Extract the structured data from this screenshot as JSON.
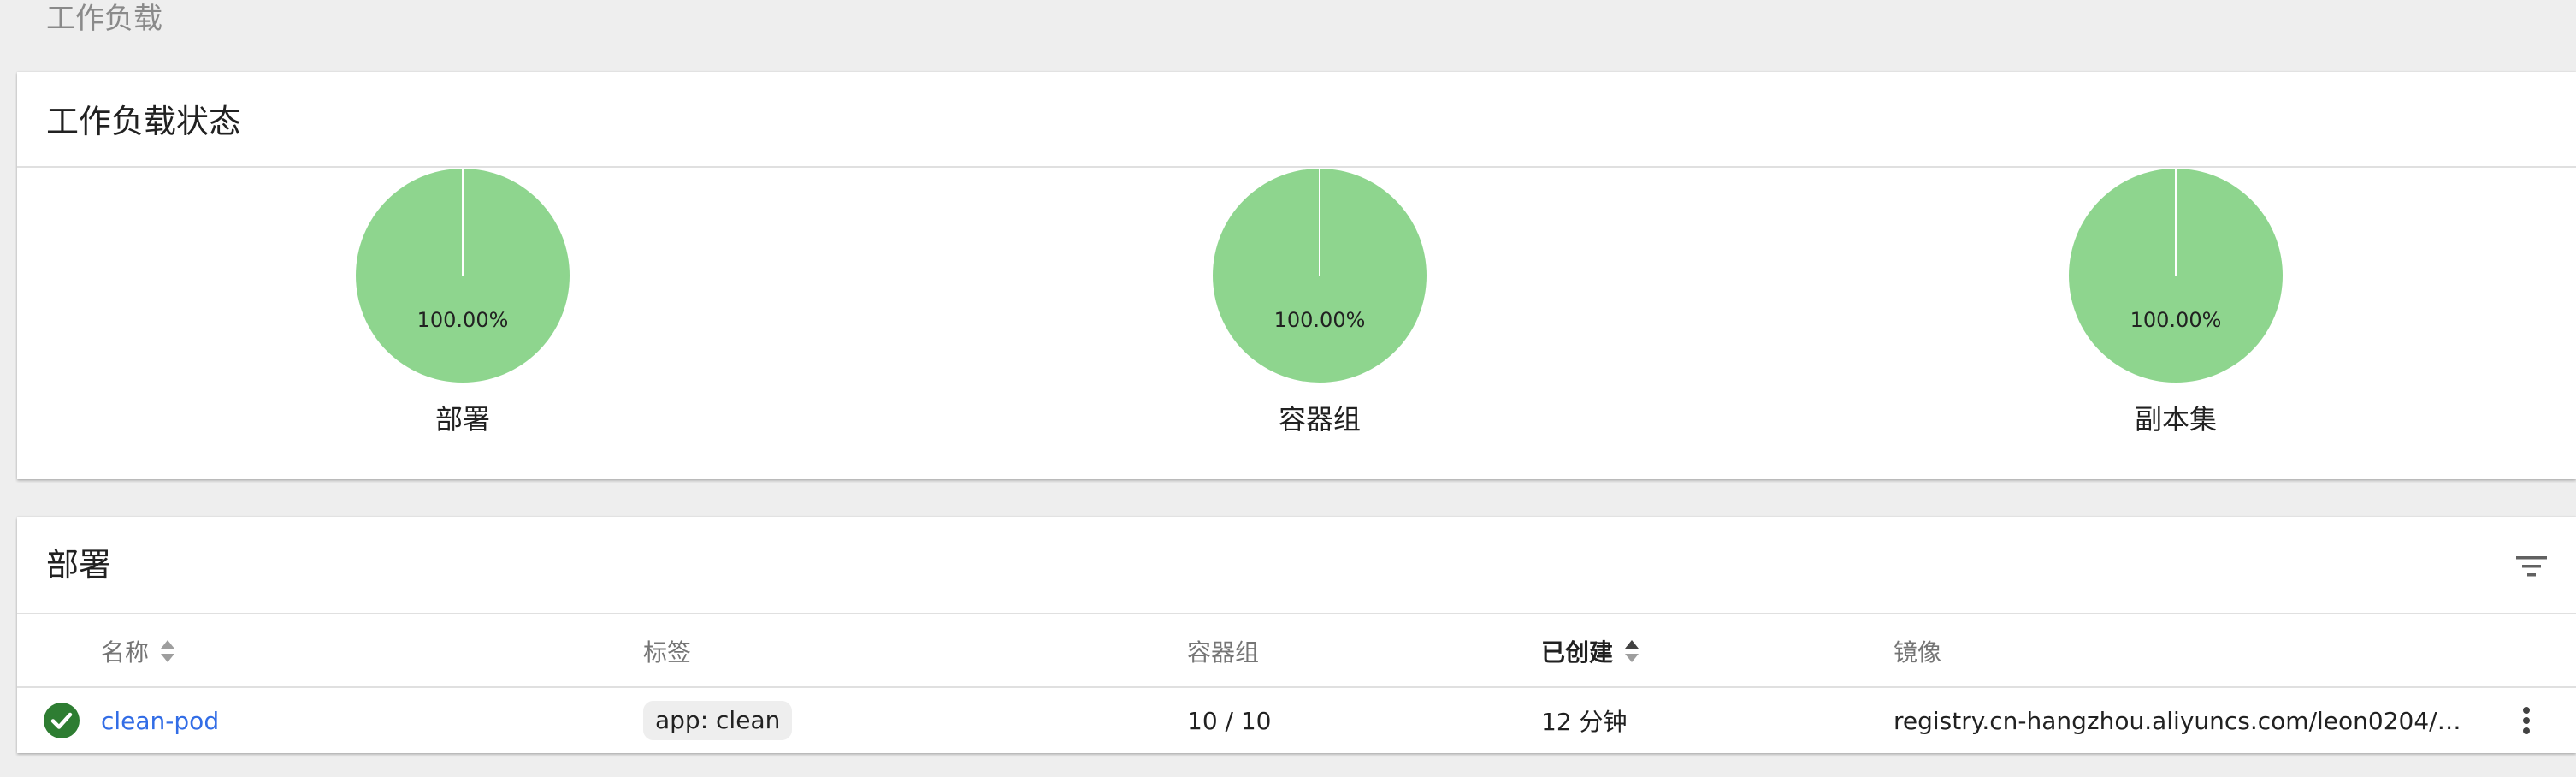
{
  "page": {
    "heading": "工作负载"
  },
  "status_card": {
    "title": "工作负载状态",
    "charts": [
      {
        "label": "部署",
        "percent_text": "100.00%",
        "running_fraction": 1.0,
        "color": "#8ed58e"
      },
      {
        "label": "容器组",
        "percent_text": "100.00%",
        "running_fraction": 1.0,
        "color": "#8ed58e"
      },
      {
        "label": "副本集",
        "percent_text": "100.00%",
        "running_fraction": 1.0,
        "color": "#8ed58e"
      }
    ]
  },
  "deploy_card": {
    "title": "部署",
    "filter_icon": "filter-icon",
    "columns": {
      "name": "名称",
      "labels": "标签",
      "pods": "容器组",
      "created": "已创建",
      "images": "镜像"
    },
    "rows": [
      {
        "status_icon": "check-circle-icon",
        "status_color": "#2e7d32",
        "name": "clean-pod",
        "label_chip": "app: clean",
        "pods": "10 / 10",
        "created": "12 分钟",
        "image": "registry.cn-hangzhou.aliyuncs.com/leon0204/…",
        "menu_icon": "more-vert-icon"
      }
    ]
  }
}
